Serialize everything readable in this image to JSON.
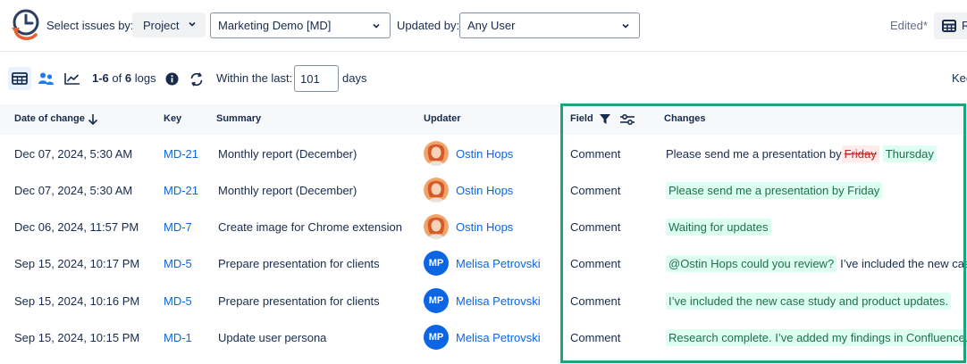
{
  "topbar": {
    "select_issues_label": "Select issues by:",
    "project_button": "Project",
    "project_value": "Marketing Demo [MD]",
    "updated_by_label": "Updated by:",
    "updated_by_value": "Any User",
    "edited": "Edited*",
    "report_label": "R"
  },
  "toolbar": {
    "count_range": "1-6",
    "count_of": "of",
    "count_total": "6",
    "count_suffix": "logs",
    "within_label": "Within the last:",
    "days_value": "101",
    "days_label": "days",
    "truncated_right": "Kee"
  },
  "table": {
    "headers": {
      "date": "Date of change",
      "key": "Key",
      "summary": "Summary",
      "updater": "Updater",
      "field": "Field",
      "changes": "Changes"
    },
    "rows": [
      {
        "date": "Dec 07, 2024, 5:30 AM",
        "key": "MD-21",
        "summary": "Monthly report (December)",
        "updater": "Ostin Hops",
        "initials": "",
        "field": "Comment",
        "change_plain": "Please send me a presentation by ",
        "change_del": "Friday",
        "change_add": "Thursday",
        "change_tail": ""
      },
      {
        "date": "Dec 07, 2024, 5:30 AM",
        "key": "MD-21",
        "summary": "Monthly report (December)",
        "updater": "Ostin Hops",
        "initials": "",
        "field": "Comment",
        "change_plain": "",
        "change_del": "",
        "change_add": "Please send me a presentation by Friday",
        "change_tail": ""
      },
      {
        "date": "Dec 06, 2024, 11:57 PM",
        "key": "MD-7",
        "summary": "Create image for Chrome extension",
        "updater": "Ostin Hops",
        "initials": "",
        "field": "Comment",
        "change_plain": "",
        "change_del": "",
        "change_add": "Waiting for updates",
        "change_tail": ""
      },
      {
        "date": "Sep 15, 2024, 10:17 PM",
        "key": "MD-5",
        "summary": "Prepare presentation for clients",
        "updater": "Melisa Petrovski",
        "initials": "MP",
        "field": "Comment",
        "change_plain": "",
        "change_del": "",
        "change_add": "@Ostin Hops could you review?",
        "change_tail": "I’ve included the new case"
      },
      {
        "date": "Sep 15, 2024, 10:16 PM",
        "key": "MD-5",
        "summary": "Prepare presentation for clients",
        "updater": "Melisa Petrovski",
        "initials": "MP",
        "field": "Comment",
        "change_plain": "",
        "change_del": "",
        "change_add": "I’ve included the new case study and product updates.",
        "change_tail": ""
      },
      {
        "date": "Sep 15, 2024, 10:15 PM",
        "key": "MD-1",
        "summary": "Update user persona",
        "updater": "Melisa Petrovski",
        "initials": "MP",
        "field": "Comment",
        "change_plain": "",
        "change_del": "",
        "change_add": "Research complete. I’ve added my findings in Confluence.",
        "change_tail": ""
      }
    ]
  },
  "colors": {
    "accent": "#0c66e4",
    "highlight_border": "#1fa37a",
    "added_bg": "#dcfff1",
    "removed_bg": "#ffeceb",
    "logo_orange": "#e5622e",
    "logo_navy": "#2c3e63"
  }
}
